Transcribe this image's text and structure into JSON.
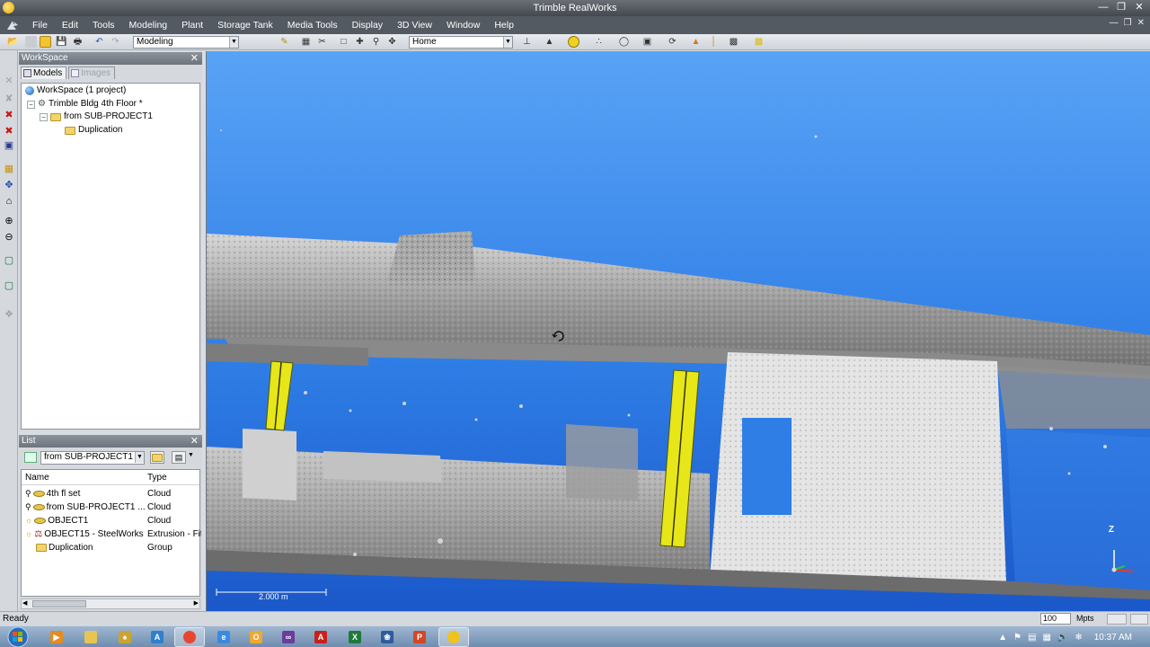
{
  "window": {
    "title": "Trimble RealWorks"
  },
  "menu": [
    "File",
    "Edit",
    "Tools",
    "Modeling",
    "Plant",
    "Storage Tank",
    "Media Tools",
    "Display",
    "3D View",
    "Window",
    "Help"
  ],
  "toolbar": {
    "mode_select": "Modeling",
    "view_select": "Home"
  },
  "workspace": {
    "title": "WorkSpace",
    "tabs": [
      "Models",
      "Images"
    ],
    "tree": [
      {
        "label": "WorkSpace  (1 project)"
      },
      {
        "label": "Trimble Bldg 4th Floor  *"
      },
      {
        "label": "from SUB-PROJECT1"
      },
      {
        "label": "Duplication"
      }
    ]
  },
  "list": {
    "title": "List",
    "filter": "from SUB-PROJECT1",
    "columns": [
      "Name",
      "Type"
    ],
    "rows": [
      {
        "name": "4th fl set",
        "type": "Cloud"
      },
      {
        "name": "from SUB-PROJECT1 ...",
        "type": "Cloud"
      },
      {
        "name": "OBJECT1",
        "type": "Cloud"
      },
      {
        "name": "OBJECT15 - SteelWorks",
        "type": "Extrusion - Fitt"
      },
      {
        "name": "Duplication",
        "type": "Group"
      }
    ]
  },
  "view": {
    "scale_label": "2.000 m",
    "axis_z": "Z"
  },
  "status": {
    "text": "Ready",
    "points": "100",
    "points_unit": "Mpts"
  },
  "taskbar": {
    "clock": "10:37 AM"
  },
  "colors": {
    "view_bg": "#2f7ee6",
    "steel": "#e6e619",
    "menubar": "#545a62"
  }
}
